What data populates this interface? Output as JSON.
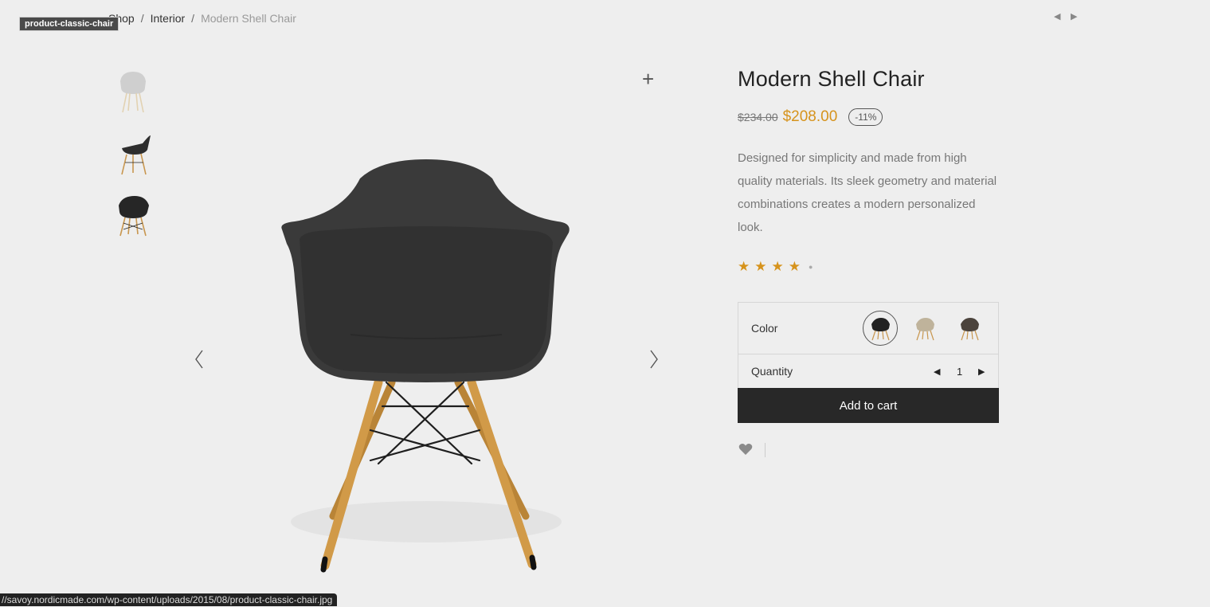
{
  "tooltip": "product-classic-chair",
  "breadcrumb": {
    "items": [
      "Shop",
      "Interior"
    ],
    "current": "Modern Shell Chair",
    "separator": "/"
  },
  "product_nav": {
    "prev": "◀",
    "next": "▶"
  },
  "gallery": {
    "thumbnails": [
      "chair-white-icon",
      "chair-black-side-icon",
      "chair-black-front-icon"
    ],
    "zoom_icon": "+"
  },
  "product": {
    "title": "Modern Shell Chair",
    "old_price": "$234.00",
    "price": "$208.00",
    "discount": "-11%",
    "description": "Designed for simplicity and made from high quality materials. Its sleek geometry and material combinations creates a modern personalized look.",
    "rating": 4,
    "rating_max": 5
  },
  "variations": {
    "color_label": "Color",
    "swatches": [
      "black",
      "beige",
      "dark-brown"
    ],
    "selected_swatch": 0,
    "quantity_label": "Quantity",
    "quantity_value": "1",
    "qty_minus": "◀",
    "qty_plus": "▶"
  },
  "add_to_cart": "Add to cart",
  "status_url": "//savoy.nordicmade.com/wp-content/uploads/2015/08/product-classic-chair.jpg",
  "colors": {
    "accent": "#d6931c",
    "button": "#282828",
    "background": "#eeeeee"
  }
}
